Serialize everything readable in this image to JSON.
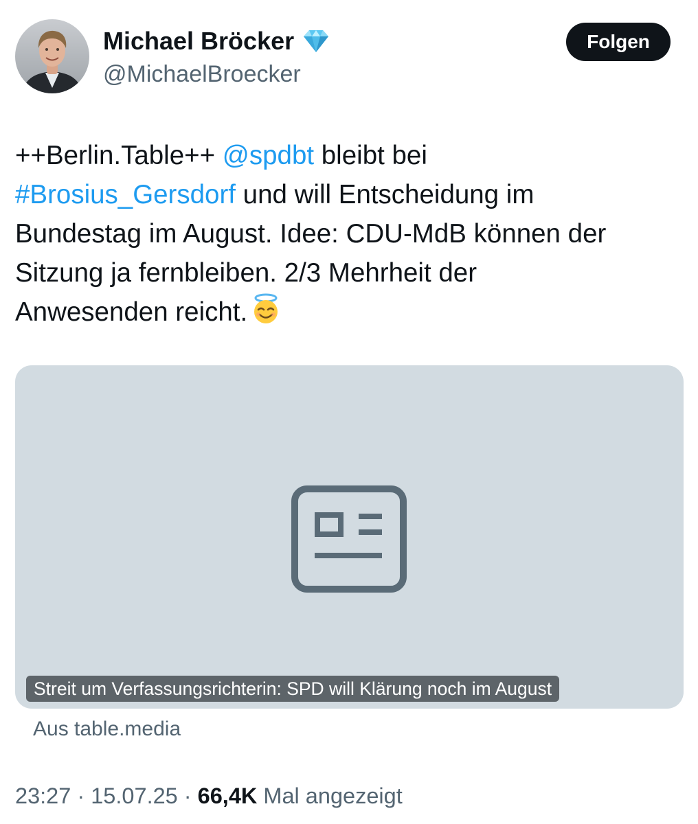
{
  "author": {
    "display_name": "Michael Bröcker",
    "handle": "@MichaelBroecker",
    "avatar_icon": "profile-photo",
    "badge_icon": "diamond-icon"
  },
  "follow_button": {
    "label": "Folgen"
  },
  "tweet": {
    "line1_prefix": "++Berlin.Table++ ",
    "mention": "@spdbt",
    "line1_suffix": " bleibt bei",
    "hashtag": "#Brosius_Gersdorf",
    "line2_suffix": " und will Entscheidung im",
    "line3": "Bundestag im August. Idee: CDU-MdB können der",
    "line4": "Sitzung ja fernbleiben. 2/3 Mehrheit der",
    "line5": "Anwesenden reicht.",
    "emoji_icon": "smiling-face-with-halo-emoji"
  },
  "link_card": {
    "placeholder_icon": "article-icon",
    "title": "Streit um Verfassungsrichterin: SPD will Klärung noch im August",
    "source": "Aus table.media"
  },
  "meta": {
    "time": "23:27",
    "separator": " · ",
    "date": "15.07.25",
    "views_count": "66,4K",
    "views_label": " Mal angezeigt"
  },
  "colors": {
    "link": "#1d9bf0",
    "text": "#0f1419",
    "secondary": "#536471",
    "card_bg": "#d2dbe1",
    "button_bg": "#0f1419"
  }
}
